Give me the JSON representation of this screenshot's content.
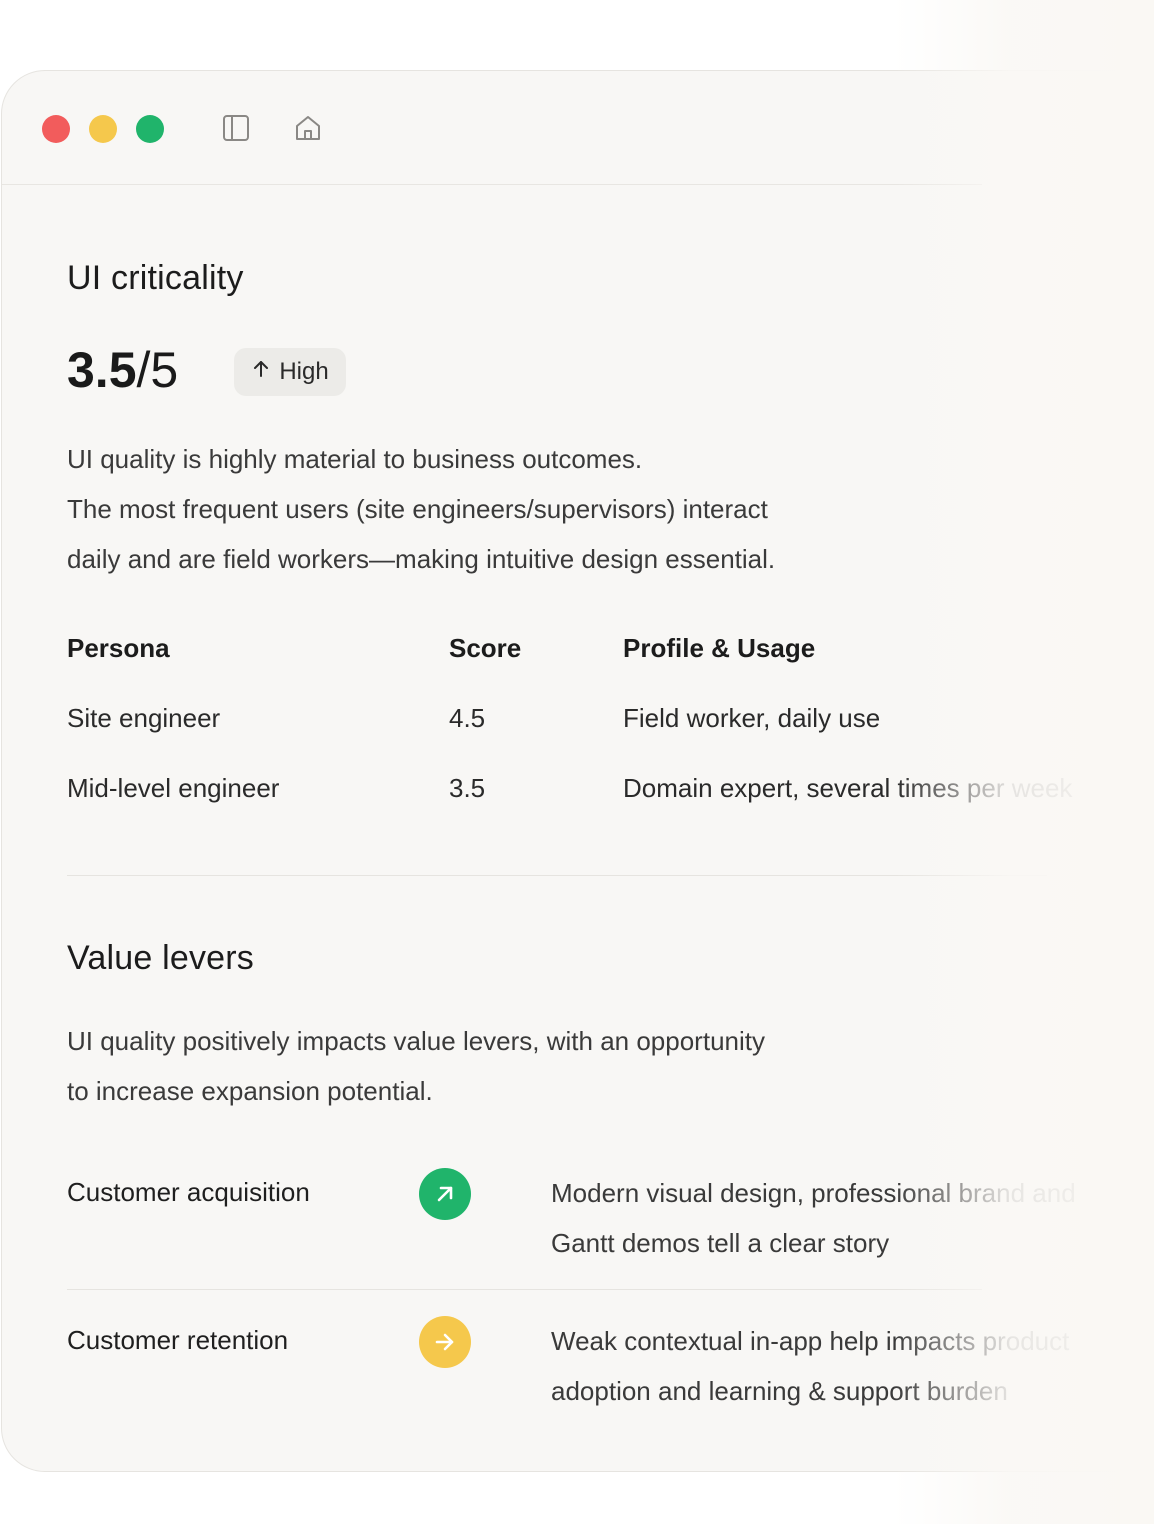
{
  "window": {
    "traffic_lights": [
      "close",
      "minimize",
      "maximize"
    ],
    "toolbar_icons": [
      "sidebar-toggle-icon",
      "home-icon"
    ]
  },
  "criticality": {
    "title": "UI criticality",
    "score_value": "3.5",
    "score_max": "/5",
    "badge_label": "High",
    "description": [
      "UI quality is highly material to business outcomes.",
      "The most frequent users (site engineers/supervisors) interact",
      "daily and are field workers—making intuitive design essential."
    ],
    "table": {
      "headers": [
        "Persona",
        "Score",
        "Profile & Usage"
      ],
      "rows": [
        [
          "Site engineer",
          "4.5",
          "Field worker, daily use"
        ],
        [
          "Mid-level engineer",
          "3.5",
          "Domain expert, several times per week"
        ]
      ]
    }
  },
  "value_levers": {
    "title": "Value levers",
    "description": [
      "UI quality positively impacts value levers, with an opportunity",
      "to increase expansion potential."
    ],
    "items": [
      {
        "name": "Customer acquisition",
        "icon": "arrow-up-right-icon",
        "color": "#20b46b",
        "desc": [
          "Modern visual design, professional brand and",
          "Gantt demos tell a clear story"
        ]
      },
      {
        "name": "Customer retention",
        "icon": "arrow-right-icon",
        "color": "#f5c84c",
        "desc": [
          "Weak contextual in-app help impacts product",
          "adoption and learning & support burden"
        ]
      }
    ]
  }
}
